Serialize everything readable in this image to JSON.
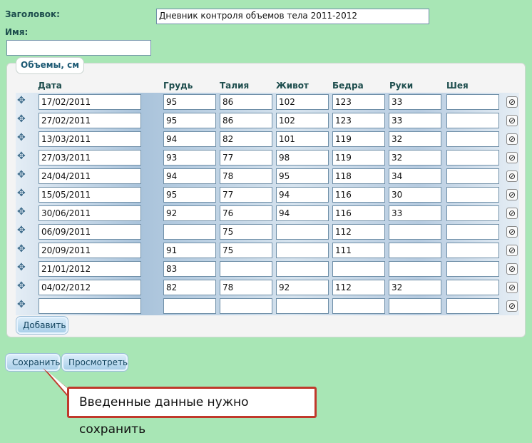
{
  "form": {
    "title_label": "Заголовок:",
    "title_value": "Дневник контроля объемов тела 2011-2012",
    "name_label": "Имя:",
    "name_value": ""
  },
  "section": {
    "legend": "Объемы, см",
    "columns": [
      "Дата",
      "Грудь",
      "Талия",
      "Живот",
      "Бедра",
      "Руки",
      "Шея"
    ],
    "rows": [
      [
        "17/02/2011",
        "95",
        "86",
        "102",
        "123",
        "33",
        ""
      ],
      [
        "27/02/2011",
        "95",
        "86",
        "102",
        "123",
        "33",
        ""
      ],
      [
        "13/03/2011",
        "94",
        "82",
        "101",
        "119",
        "32",
        ""
      ],
      [
        "27/03/2011",
        "93",
        "77",
        "98",
        "119",
        "32",
        ""
      ],
      [
        "24/04/2011",
        "94",
        "78",
        "95",
        "118",
        "34",
        ""
      ],
      [
        "15/05/2011",
        "95",
        "77",
        "94",
        "116",
        "30",
        ""
      ],
      [
        "30/06/2011",
        "92",
        "76",
        "94",
        "116",
        "33",
        ""
      ],
      [
        "06/09/2011",
        "",
        "75",
        "",
        "112",
        "",
        ""
      ],
      [
        "20/09/2011",
        "91",
        "75",
        "",
        "111",
        "",
        ""
      ],
      [
        "21/01/2012",
        "83",
        "",
        "",
        "",
        "",
        ""
      ],
      [
        "04/02/2012",
        "82",
        "78",
        "92",
        "112",
        "32",
        ""
      ],
      [
        "",
        "",
        "",
        "",
        "",
        "",
        ""
      ]
    ],
    "add_button": "Добавить"
  },
  "actions": {
    "save": "Сохранить",
    "preview": "Просмотреть"
  },
  "callout": "Введенные данные нужно сохранить",
  "icons": {
    "drag": "move-handle-icon",
    "delete": "no-entry-icon"
  },
  "colors": {
    "background": "#a8e6b5",
    "callout_border": "#c0392b",
    "label": "#1d4d4d"
  }
}
